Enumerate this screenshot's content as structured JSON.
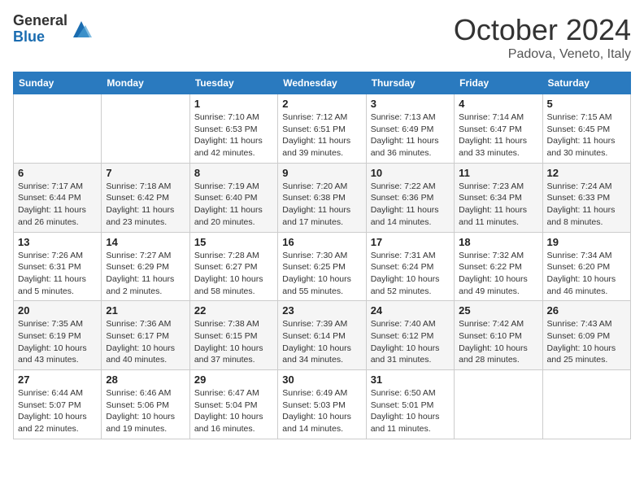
{
  "logo": {
    "general": "General",
    "blue": "Blue"
  },
  "title": {
    "month": "October 2024",
    "location": "Padova, Veneto, Italy"
  },
  "headers": [
    "Sunday",
    "Monday",
    "Tuesday",
    "Wednesday",
    "Thursday",
    "Friday",
    "Saturday"
  ],
  "weeks": [
    [
      {
        "day": "",
        "sunrise": "",
        "sunset": "",
        "daylight": ""
      },
      {
        "day": "",
        "sunrise": "",
        "sunset": "",
        "daylight": ""
      },
      {
        "day": "1",
        "sunrise": "Sunrise: 7:10 AM",
        "sunset": "Sunset: 6:53 PM",
        "daylight": "Daylight: 11 hours and 42 minutes."
      },
      {
        "day": "2",
        "sunrise": "Sunrise: 7:12 AM",
        "sunset": "Sunset: 6:51 PM",
        "daylight": "Daylight: 11 hours and 39 minutes."
      },
      {
        "day": "3",
        "sunrise": "Sunrise: 7:13 AM",
        "sunset": "Sunset: 6:49 PM",
        "daylight": "Daylight: 11 hours and 36 minutes."
      },
      {
        "day": "4",
        "sunrise": "Sunrise: 7:14 AM",
        "sunset": "Sunset: 6:47 PM",
        "daylight": "Daylight: 11 hours and 33 minutes."
      },
      {
        "day": "5",
        "sunrise": "Sunrise: 7:15 AM",
        "sunset": "Sunset: 6:45 PM",
        "daylight": "Daylight: 11 hours and 30 minutes."
      }
    ],
    [
      {
        "day": "6",
        "sunrise": "Sunrise: 7:17 AM",
        "sunset": "Sunset: 6:44 PM",
        "daylight": "Daylight: 11 hours and 26 minutes."
      },
      {
        "day": "7",
        "sunrise": "Sunrise: 7:18 AM",
        "sunset": "Sunset: 6:42 PM",
        "daylight": "Daylight: 11 hours and 23 minutes."
      },
      {
        "day": "8",
        "sunrise": "Sunrise: 7:19 AM",
        "sunset": "Sunset: 6:40 PM",
        "daylight": "Daylight: 11 hours and 20 minutes."
      },
      {
        "day": "9",
        "sunrise": "Sunrise: 7:20 AM",
        "sunset": "Sunset: 6:38 PM",
        "daylight": "Daylight: 11 hours and 17 minutes."
      },
      {
        "day": "10",
        "sunrise": "Sunrise: 7:22 AM",
        "sunset": "Sunset: 6:36 PM",
        "daylight": "Daylight: 11 hours and 14 minutes."
      },
      {
        "day": "11",
        "sunrise": "Sunrise: 7:23 AM",
        "sunset": "Sunset: 6:34 PM",
        "daylight": "Daylight: 11 hours and 11 minutes."
      },
      {
        "day": "12",
        "sunrise": "Sunrise: 7:24 AM",
        "sunset": "Sunset: 6:33 PM",
        "daylight": "Daylight: 11 hours and 8 minutes."
      }
    ],
    [
      {
        "day": "13",
        "sunrise": "Sunrise: 7:26 AM",
        "sunset": "Sunset: 6:31 PM",
        "daylight": "Daylight: 11 hours and 5 minutes."
      },
      {
        "day": "14",
        "sunrise": "Sunrise: 7:27 AM",
        "sunset": "Sunset: 6:29 PM",
        "daylight": "Daylight: 11 hours and 2 minutes."
      },
      {
        "day": "15",
        "sunrise": "Sunrise: 7:28 AM",
        "sunset": "Sunset: 6:27 PM",
        "daylight": "Daylight: 10 hours and 58 minutes."
      },
      {
        "day": "16",
        "sunrise": "Sunrise: 7:30 AM",
        "sunset": "Sunset: 6:25 PM",
        "daylight": "Daylight: 10 hours and 55 minutes."
      },
      {
        "day": "17",
        "sunrise": "Sunrise: 7:31 AM",
        "sunset": "Sunset: 6:24 PM",
        "daylight": "Daylight: 10 hours and 52 minutes."
      },
      {
        "day": "18",
        "sunrise": "Sunrise: 7:32 AM",
        "sunset": "Sunset: 6:22 PM",
        "daylight": "Daylight: 10 hours and 49 minutes."
      },
      {
        "day": "19",
        "sunrise": "Sunrise: 7:34 AM",
        "sunset": "Sunset: 6:20 PM",
        "daylight": "Daylight: 10 hours and 46 minutes."
      }
    ],
    [
      {
        "day": "20",
        "sunrise": "Sunrise: 7:35 AM",
        "sunset": "Sunset: 6:19 PM",
        "daylight": "Daylight: 10 hours and 43 minutes."
      },
      {
        "day": "21",
        "sunrise": "Sunrise: 7:36 AM",
        "sunset": "Sunset: 6:17 PM",
        "daylight": "Daylight: 10 hours and 40 minutes."
      },
      {
        "day": "22",
        "sunrise": "Sunrise: 7:38 AM",
        "sunset": "Sunset: 6:15 PM",
        "daylight": "Daylight: 10 hours and 37 minutes."
      },
      {
        "day": "23",
        "sunrise": "Sunrise: 7:39 AM",
        "sunset": "Sunset: 6:14 PM",
        "daylight": "Daylight: 10 hours and 34 minutes."
      },
      {
        "day": "24",
        "sunrise": "Sunrise: 7:40 AM",
        "sunset": "Sunset: 6:12 PM",
        "daylight": "Daylight: 10 hours and 31 minutes."
      },
      {
        "day": "25",
        "sunrise": "Sunrise: 7:42 AM",
        "sunset": "Sunset: 6:10 PM",
        "daylight": "Daylight: 10 hours and 28 minutes."
      },
      {
        "day": "26",
        "sunrise": "Sunrise: 7:43 AM",
        "sunset": "Sunset: 6:09 PM",
        "daylight": "Daylight: 10 hours and 25 minutes."
      }
    ],
    [
      {
        "day": "27",
        "sunrise": "Sunrise: 6:44 AM",
        "sunset": "Sunset: 5:07 PM",
        "daylight": "Daylight: 10 hours and 22 minutes."
      },
      {
        "day": "28",
        "sunrise": "Sunrise: 6:46 AM",
        "sunset": "Sunset: 5:06 PM",
        "daylight": "Daylight: 10 hours and 19 minutes."
      },
      {
        "day": "29",
        "sunrise": "Sunrise: 6:47 AM",
        "sunset": "Sunset: 5:04 PM",
        "daylight": "Daylight: 10 hours and 16 minutes."
      },
      {
        "day": "30",
        "sunrise": "Sunrise: 6:49 AM",
        "sunset": "Sunset: 5:03 PM",
        "daylight": "Daylight: 10 hours and 14 minutes."
      },
      {
        "day": "31",
        "sunrise": "Sunrise: 6:50 AM",
        "sunset": "Sunset: 5:01 PM",
        "daylight": "Daylight: 10 hours and 11 minutes."
      },
      {
        "day": "",
        "sunrise": "",
        "sunset": "",
        "daylight": ""
      },
      {
        "day": "",
        "sunrise": "",
        "sunset": "",
        "daylight": ""
      }
    ]
  ]
}
